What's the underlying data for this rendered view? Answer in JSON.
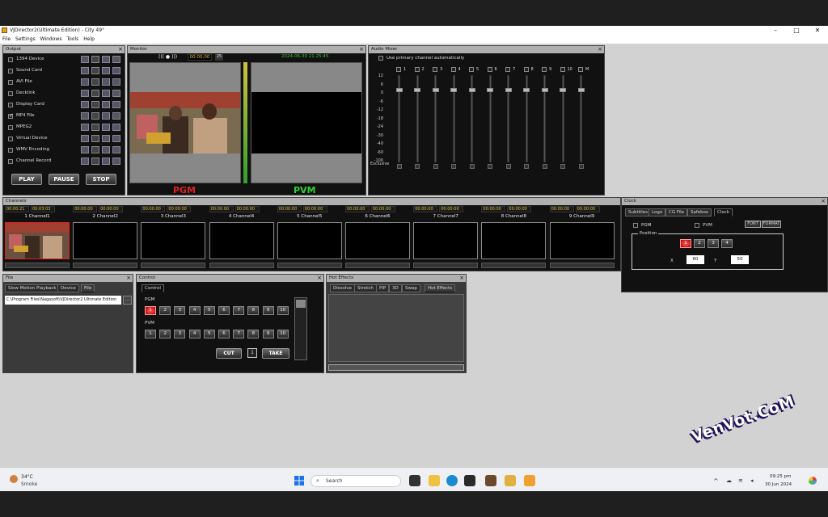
{
  "window": {
    "title": "VJDirector2(Ultimate Edition) - City 49°",
    "minimize": "–",
    "maximize": "□",
    "close": "✕"
  },
  "menu": [
    "File",
    "Settings",
    "Windows",
    "Tools",
    "Help"
  ],
  "output": {
    "title": "Output",
    "items": [
      {
        "label": "1394 Device",
        "checked": false
      },
      {
        "label": "Sound Card",
        "checked": false
      },
      {
        "label": "AVI File",
        "checked": false
      },
      {
        "label": "Decklink",
        "checked": false
      },
      {
        "label": "Display Card",
        "checked": false
      },
      {
        "label": "MP4 File",
        "checked": true
      },
      {
        "label": "MPEG2",
        "checked": false
      },
      {
        "label": "Virtual Device",
        "checked": false
      },
      {
        "label": "WMV Encoding",
        "checked": false
      },
      {
        "label": "Channel Record",
        "checked": false
      }
    ],
    "play": "PLAY",
    "pause": "PAUSE",
    "stop": "STOP"
  },
  "monitor": {
    "title": "Monitor",
    "timecode": "00:00:00",
    "marker": "25",
    "datetime": "2024-06-30 21:25:45",
    "pgm": "PGM",
    "pvm": "PVM"
  },
  "audio": {
    "title": "Audio Mixer",
    "auto_label": "Use primary channel automatically",
    "scale": [
      "12",
      "6",
      "0",
      "-6",
      "-12",
      "-18",
      "-24",
      "-30",
      "-40",
      "-60",
      "-100"
    ],
    "exclusive": "Exclusive",
    "channels": [
      "1",
      "2",
      "3",
      "4",
      "5",
      "6",
      "7",
      "8",
      "9",
      "10",
      "M"
    ]
  },
  "channels": {
    "title": "Channels",
    "items": [
      {
        "name": "1 Channel1",
        "t1": "00:00:21",
        "t2": "00:03:03"
      },
      {
        "name": "2 Channel2",
        "t1": "00:00:00",
        "t2": "00:00:00"
      },
      {
        "name": "3 Channel3",
        "t1": "00:00:00",
        "t2": "00:00:00"
      },
      {
        "name": "4 Channel4",
        "t1": "00:00:00",
        "t2": "00:00:00"
      },
      {
        "name": "5 Channel5",
        "t1": "00:00:00",
        "t2": "00:00:00"
      },
      {
        "name": "6 Channel6",
        "t1": "00:00:00",
        "t2": "00:00:00"
      },
      {
        "name": "7 Channel7",
        "t1": "00:00:00",
        "t2": "00:00:00"
      },
      {
        "name": "8 Channel8",
        "t1": "00:00:00",
        "t2": "00:00:00"
      },
      {
        "name": "9 Channel9",
        "t1": "00:00:00",
        "t2": "00:00:00"
      }
    ]
  },
  "clock": {
    "title": "Clock",
    "tabs": [
      "Subtitles",
      "Logo",
      "CG File",
      "Safebox",
      "Clock"
    ],
    "pgm": "PGM",
    "pvm": "PVM",
    "font": "FONT",
    "format": "FORMAT",
    "position": "Position",
    "positions": [
      "1",
      "2",
      "3",
      "4"
    ],
    "x_label": "X",
    "x": "60",
    "y_label": "Y",
    "y": "50"
  },
  "file": {
    "title": "File",
    "tabs": [
      "Slow Motion Playback",
      "Device",
      "File"
    ],
    "path": "C:\\Program Files\\Nagasoft\\VJDirector2 Ultimate Edition",
    "browse": "..."
  },
  "control": {
    "title": "Control",
    "tab": "Control",
    "pgm": "PGM",
    "pvm": "PVM",
    "numbers": [
      "1",
      "2",
      "3",
      "4",
      "5",
      "6",
      "7",
      "8",
      "9",
      "10"
    ],
    "cut": "CUT",
    "value": "1",
    "take": "TAKE"
  },
  "hot": {
    "title": "Hot Effects",
    "tabs": [
      "Dissolve",
      "Stretch",
      "PIP",
      "3D",
      "Swap",
      "Hot Effects"
    ]
  },
  "taskbar": {
    "weather_temp": "34°C",
    "weather_desc": "Smoke",
    "search": "Search",
    "time": "09:25 pm",
    "date": "30 Jun 2024"
  },
  "watermark": "VenVot.CoM",
  "colors": {
    "pgm": "#e02020",
    "pvm": "#30d030",
    "timecode": "#e0c040",
    "active_button": "#ff4040"
  }
}
